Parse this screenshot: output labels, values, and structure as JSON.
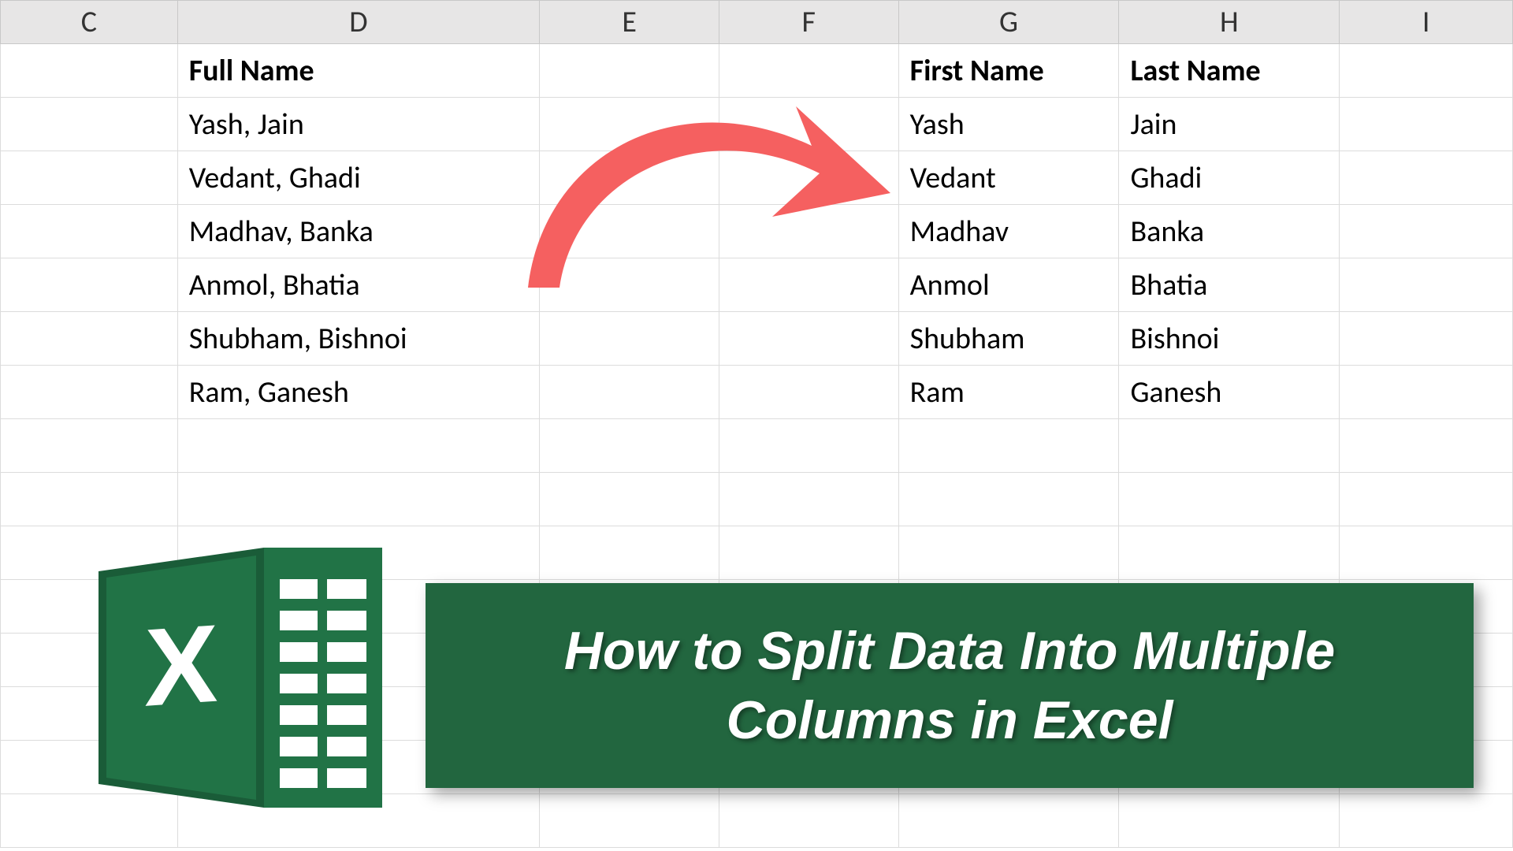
{
  "columns": {
    "c": "C",
    "d": "D",
    "e": "E",
    "f": "F",
    "g": "G",
    "h": "H",
    "i": "I"
  },
  "headers": {
    "fullName": "Full Name",
    "firstName": "First Name",
    "lastName": "Last Name"
  },
  "rows": [
    {
      "full": "Yash, Jain",
      "first": "Yash",
      "last": "Jain"
    },
    {
      "full": "Vedant, Ghadi",
      "first": "Vedant",
      "last": "Ghadi"
    },
    {
      "full": "Madhav, Banka",
      "first": "Madhav",
      "last": "Banka"
    },
    {
      "full": "Anmol, Bhatia",
      "first": "Anmol",
      "last": "Bhatia"
    },
    {
      "full": "Shubham, Bishnoi",
      "first": "Shubham",
      "last": "Bishnoi"
    },
    {
      "full": "Ram, Ganesh",
      "first": "Ram",
      "last": "Ganesh"
    }
  ],
  "banner": {
    "title": "How to Split Data Into Multiple Columns in Excel"
  },
  "colors": {
    "arrow": "#f56060",
    "banner": "#22663f",
    "excelGreen": "#217346"
  }
}
